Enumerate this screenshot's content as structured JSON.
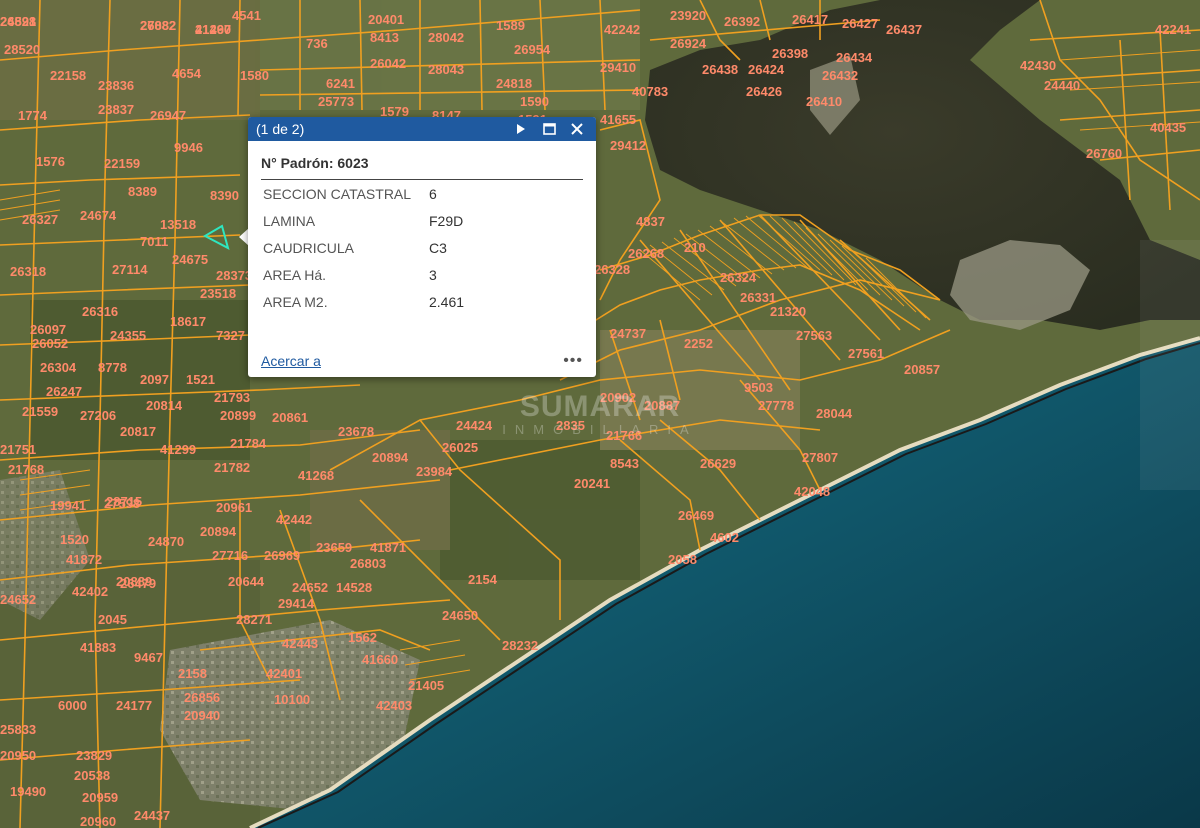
{
  "popup": {
    "count": "(1 de 2)",
    "title": "N° Padrón: 6023",
    "attributes": [
      {
        "name": "SECCION CATASTRAL",
        "value": "6"
      },
      {
        "name": "LAMINA",
        "value": "F29D"
      },
      {
        "name": "CAUDRICULA",
        "value": "C3"
      },
      {
        "name": "AREA Há.",
        "value": "3"
      },
      {
        "name": "AREA M2.",
        "value": "2.461"
      }
    ],
    "zoom_link": "Acercar a",
    "more_label": "•••",
    "icons": [
      "play-icon",
      "maximize-icon",
      "close-icon"
    ]
  },
  "watermark": {
    "main": "SUMARAR",
    "sub": "INMOBILIARIA"
  },
  "parcel_labels": [
    "24521",
    "27082",
    "41467",
    "4541",
    "20401",
    "1589",
    "42242",
    "23920",
    "26392",
    "26417",
    "26427",
    "26437",
    "42241",
    "28520",
    "736",
    "8413",
    "28042",
    "26954",
    "29410",
    "26924",
    "26398",
    "26434",
    "42430",
    "22158",
    "23836",
    "4654",
    "1580",
    "26042",
    "6241",
    "28043",
    "24818",
    "40783",
    "26424",
    "26432",
    "26438",
    "26426",
    "24440",
    "1774",
    "23837",
    "26947",
    "25773",
    "1579",
    "8147",
    "1590",
    "1591",
    "41655",
    "29412",
    "26410",
    "40435",
    "26760",
    "23838",
    "9946",
    "1576",
    "22159",
    "8389",
    "8390",
    "4837",
    "26327",
    "24674",
    "13518",
    "7011",
    "24675",
    "28373",
    "26268",
    "210",
    "26328",
    "26324",
    "26331",
    "26318",
    "27114",
    "23518",
    "21320",
    "26316",
    "26097",
    "24355",
    "18617",
    "7327",
    "24737",
    "2252",
    "27563",
    "27561",
    "26052",
    "26304",
    "8778",
    "2097",
    "1521",
    "20857",
    "20902",
    "26247",
    "21793",
    "20814",
    "20899",
    "20861",
    "20887",
    "9503",
    "27778",
    "28044",
    "21559",
    "27206",
    "20817",
    "23678",
    "24424",
    "2835",
    "21766",
    "21751",
    "21784",
    "41299",
    "20894",
    "26025",
    "8543",
    "21768",
    "21782",
    "41268",
    "23984",
    "26629",
    "27807",
    "19941",
    "27598",
    "24870",
    "20894",
    "42442",
    "20241",
    "23659",
    "41871",
    "26469",
    "42048",
    "41872",
    "27716",
    "26969",
    "26803",
    "4602",
    "26479",
    "20644",
    "24652",
    "14528",
    "2154",
    "2045",
    "29414",
    "24650",
    "2058",
    "42402",
    "41883",
    "28271",
    "42443",
    "1562",
    "28232",
    "9467",
    "2158",
    "42401",
    "41660",
    "6000",
    "24177",
    "26856",
    "10100",
    "21405",
    "20940",
    "42403",
    "25833",
    "20950",
    "23829",
    "20538",
    "19490",
    "20959",
    "20960",
    "24437",
    "20961",
    "20889",
    "28715",
    "1520",
    "24652",
    "26898",
    "26882",
    "21290"
  ]
}
